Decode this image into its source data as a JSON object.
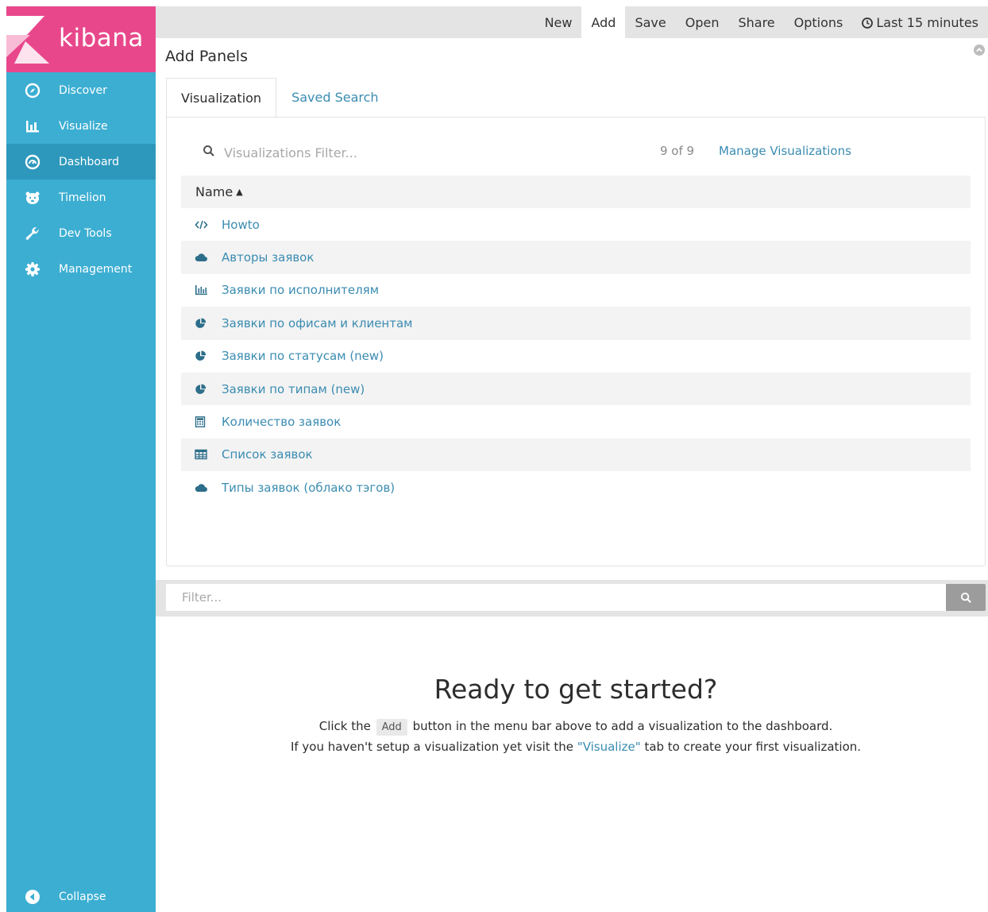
{
  "colors": {
    "sidebar": "#3caed2",
    "sidebar_active": "#2d98bc",
    "brand": "#e8488b",
    "link": "#3b8cb1",
    "topbar": "#e4e4e4"
  },
  "sidebar": {
    "brand_name": "kibana",
    "items": [
      {
        "label": "Discover",
        "icon": "compass-icon"
      },
      {
        "label": "Visualize",
        "icon": "bar-chart-icon"
      },
      {
        "label": "Dashboard",
        "icon": "dashboard-gauge-icon",
        "active": true
      },
      {
        "label": "Timelion",
        "icon": "timelion-bear-icon"
      },
      {
        "label": "Dev Tools",
        "icon": "wrench-icon"
      },
      {
        "label": "Management",
        "icon": "gear-icon"
      }
    ],
    "collapse_label": "Collapse"
  },
  "topmenu": {
    "new": "New",
    "add": "Add",
    "save": "Save",
    "open": "Open",
    "share": "Share",
    "options": "Options",
    "time": "Last 15 minutes"
  },
  "add_panels": {
    "title": "Add Panels",
    "tabs": [
      "Visualization",
      "Saved Search"
    ],
    "filter_placeholder": "Visualizations Filter...",
    "count": "9 of 9",
    "manage_link": "Manage Visualizations",
    "column_header": "Name",
    "rows": [
      {
        "label": "Howto",
        "icon": "code-icon"
      },
      {
        "label": "Авторы заявок",
        "icon": "cloud-icon"
      },
      {
        "label": "Заявки по исполнителям",
        "icon": "bar-chart-icon"
      },
      {
        "label": "Заявки по офисам и клиентам",
        "icon": "pie-chart-icon"
      },
      {
        "label": "Заявки по статусам (new)",
        "icon": "pie-chart-icon"
      },
      {
        "label": "Заявки по типам (new)",
        "icon": "pie-chart-icon"
      },
      {
        "label": "Количество заявок",
        "icon": "calculator-icon"
      },
      {
        "label": "Список заявок",
        "icon": "table-icon"
      },
      {
        "label": "Типы заявок (облако тэгов)",
        "icon": "cloud-icon"
      }
    ]
  },
  "filter_bar": {
    "placeholder": "Filter..."
  },
  "empty_state": {
    "title": "Ready to get started?",
    "line1_before": "Click the",
    "line1_key": "Add",
    "line1_after": "button in the menu bar above to add a visualization to the dashboard.",
    "line2_before": "If you haven't setup a visualization yet visit the",
    "line2_link": "\"Visualize\"",
    "line2_after": "tab to create your first visualization."
  }
}
